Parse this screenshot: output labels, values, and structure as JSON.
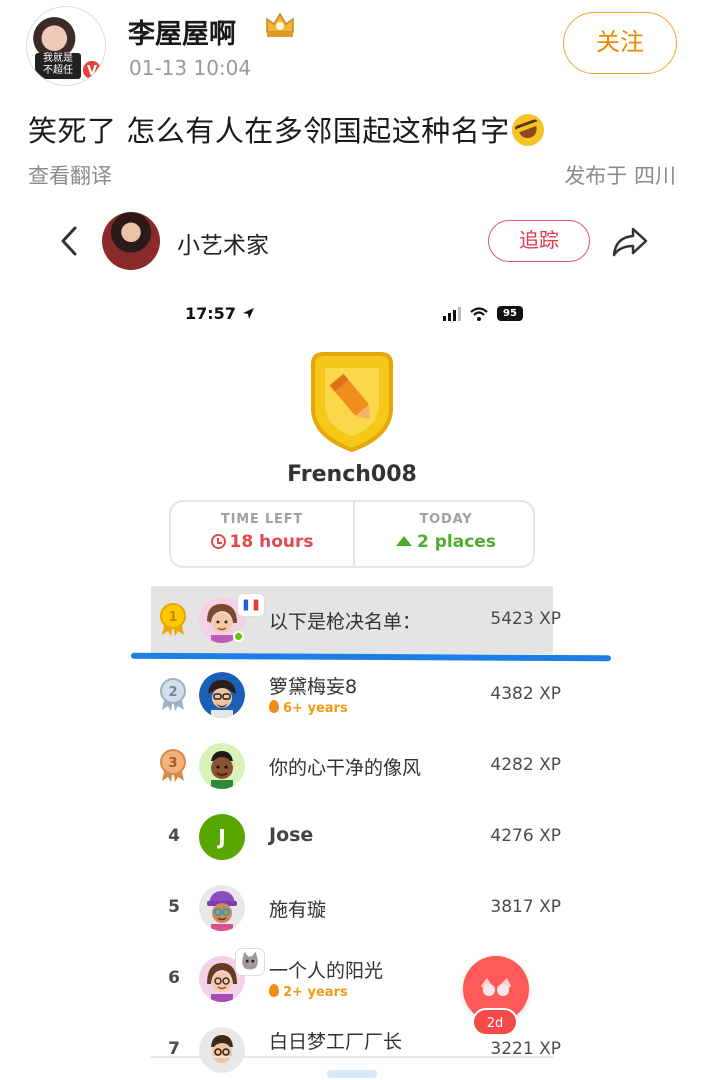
{
  "post": {
    "author": "李屋屋啊",
    "avatar_caption_1": "我就是",
    "avatar_caption_2": "不超任",
    "verified_mark": "V",
    "timestamp": "01-13 10:04",
    "follow_label": "关注",
    "text": "笑死了 怎么有人在多邻国起这种名字",
    "translate_label": "查看翻译",
    "location": "发布于 四川"
  },
  "embedded": {
    "username": "小艺术家",
    "follow_label": "追踪",
    "status_time": "17:57",
    "battery": "95",
    "league_name": "French008",
    "stats": {
      "time_left_label": "TIME LEFT",
      "time_left_value": "18 hours",
      "today_label": "TODAY",
      "today_value": "2 places"
    },
    "leaderboard": [
      {
        "rank": "1",
        "name": "以下是枪决名单：",
        "xp": "5423 XP",
        "streak": ""
      },
      {
        "rank": "2",
        "name": "箩黛梅妄8",
        "xp": "4382 XP",
        "streak": "6+ years"
      },
      {
        "rank": "3",
        "name": "你的心干净的像风",
        "xp": "4282 XP",
        "streak": ""
      },
      {
        "rank": "4",
        "name": "Jose",
        "xp": "4276 XP",
        "streak": "",
        "initial": "J"
      },
      {
        "rank": "5",
        "name": "施有璇",
        "xp": "3817 XP",
        "streak": ""
      },
      {
        "rank": "6",
        "name": "一个人的阳光",
        "xp": "",
        "streak": "2+ years"
      },
      {
        "rank": "7",
        "name": "白日梦工厂厂长",
        "xp": "3221 XP",
        "streak": ""
      }
    ],
    "fab_badge": "2d"
  },
  "colors": {
    "follow_orange": "#ef8a00",
    "duo_red": "#e5474f",
    "duo_green": "#4cad2c",
    "highlight_blue": "#1d7fe6"
  }
}
